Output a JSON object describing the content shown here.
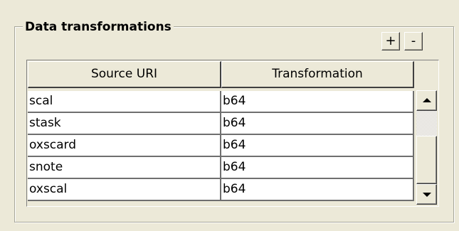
{
  "group": {
    "title": "Data transformations"
  },
  "toolbar": {
    "add_label": "+",
    "remove_label": "-"
  },
  "table": {
    "columns": [
      "Source URI",
      "Transformation"
    ],
    "rows": [
      {
        "source": "scal",
        "transformation": "b64"
      },
      {
        "source": "stask",
        "transformation": "b64"
      },
      {
        "source": "oxscard",
        "transformation": "b64"
      },
      {
        "source": "snote",
        "transformation": "b64"
      },
      {
        "source": "oxscal",
        "transformation": "b64"
      }
    ]
  },
  "scrollbar": {
    "up_icon": "arrow-up-icon",
    "down_icon": "arrow-down-icon"
  },
  "colors": {
    "face": "#ece9d8",
    "cell_background": "#ffffff",
    "grid_line": "#6f6f6f"
  }
}
